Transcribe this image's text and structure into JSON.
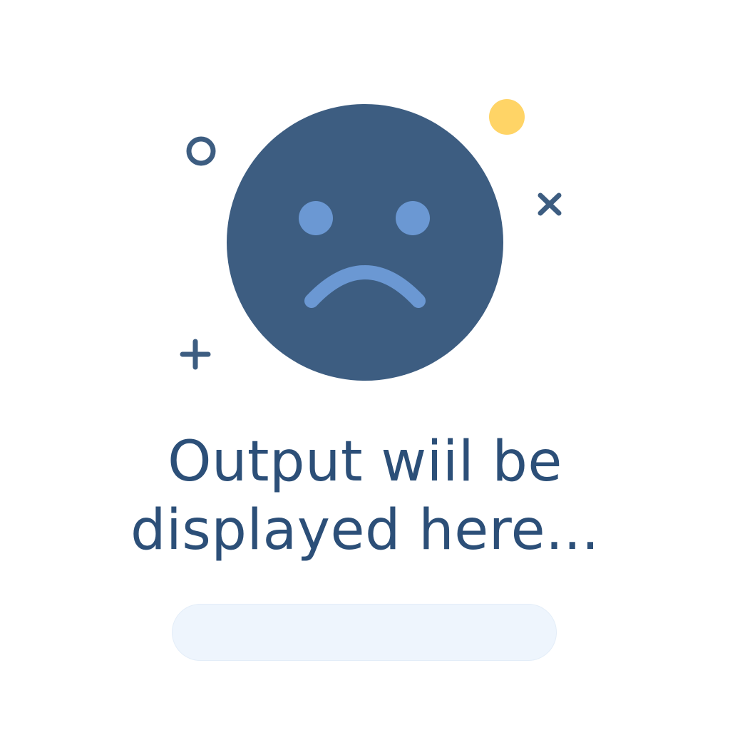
{
  "empty_state": {
    "icon": "sad-face-icon",
    "message_line1": "Output wiil be",
    "message_line2": "displayed here...",
    "colors": {
      "face": "#3d5d81",
      "features": "#6b98d3",
      "accent_dot": "#ffd466",
      "decorations": "#3d5d81",
      "text": "#2c4f78",
      "output_bar": "#eef5fd"
    }
  },
  "decorations": [
    "ring-icon",
    "dot-icon",
    "cross-icon",
    "plus-icon"
  ],
  "output_bar": {
    "value": ""
  }
}
